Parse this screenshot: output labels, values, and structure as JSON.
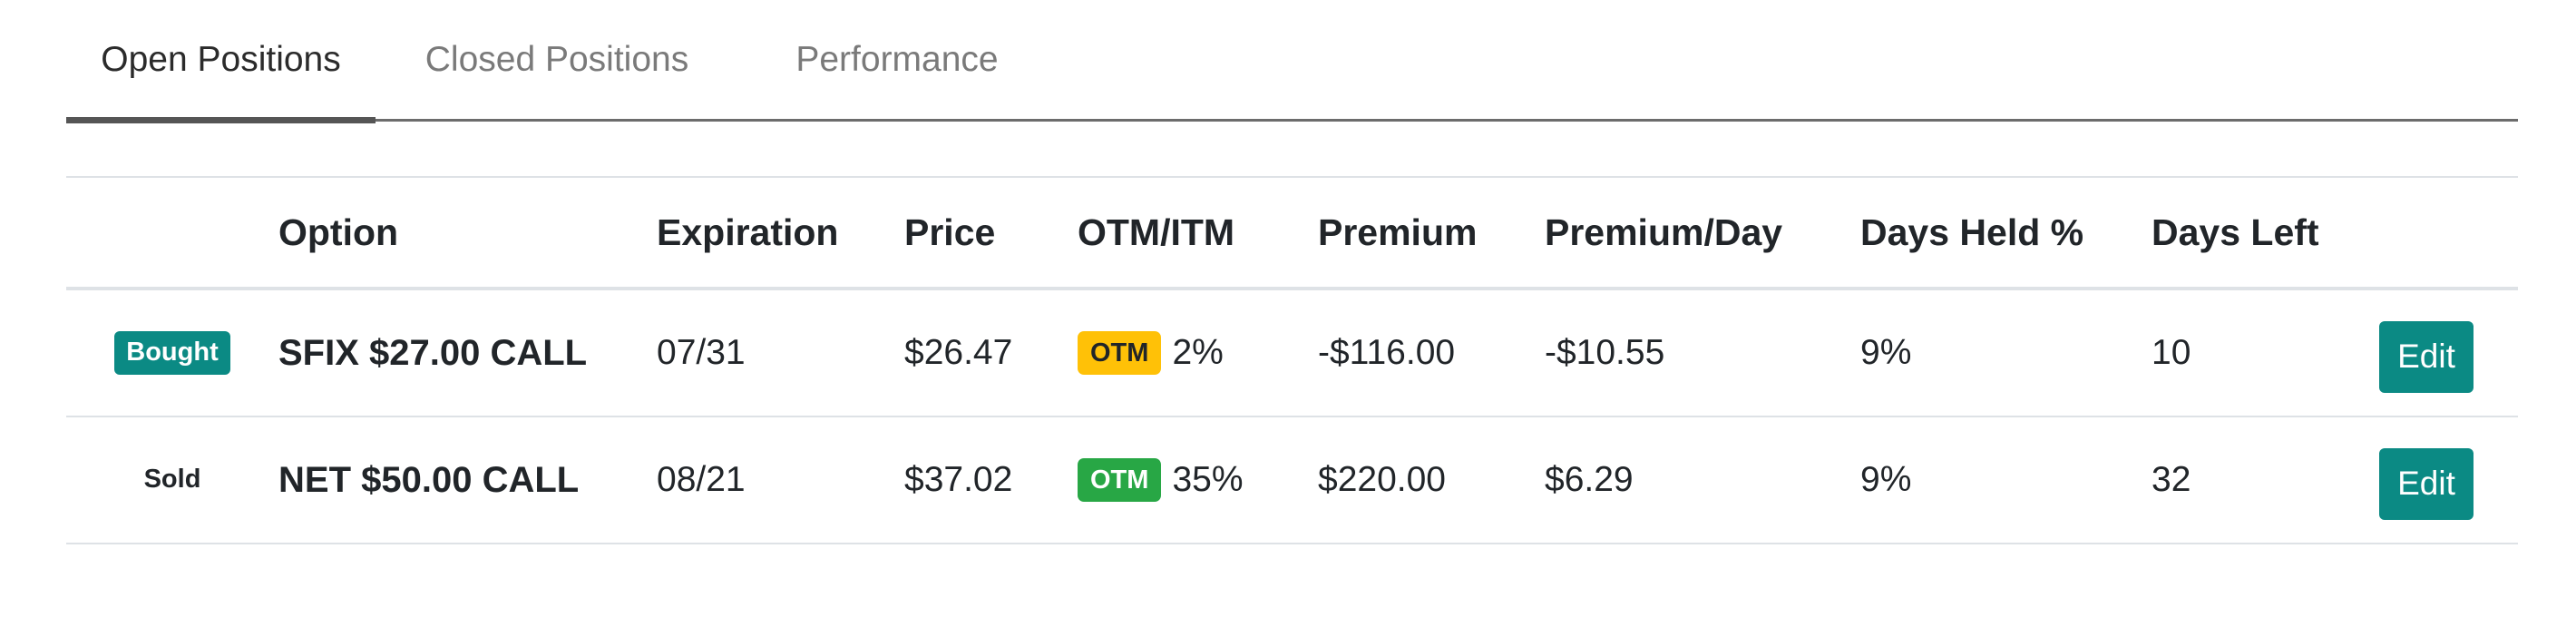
{
  "tabs": [
    {
      "label": "Open Positions",
      "active": true
    },
    {
      "label": "Closed Positions",
      "active": false
    },
    {
      "label": "Performance",
      "active": false
    }
  ],
  "table": {
    "columns": [
      "",
      "Option",
      "Expiration",
      "Price",
      "OTM/ITM",
      "Premium",
      "Premium/Day",
      "Days Held %",
      "Days Left",
      ""
    ],
    "rows": [
      {
        "side": "Bought",
        "option": "SFIX $27.00 CALL",
        "expiration": "07/31",
        "price": "$26.47",
        "moneyness": "OTM",
        "moneyness_pct": "2%",
        "premium": "-$116.00",
        "premium_per_day": "-$10.55",
        "days_held_pct": "9%",
        "days_left": "10",
        "action": "Edit"
      },
      {
        "side": "Sold",
        "option": "NET $50.00 CALL",
        "expiration": "08/21",
        "price": "$37.02",
        "moneyness": "OTM",
        "moneyness_pct": "35%",
        "premium": "$220.00",
        "premium_per_day": "$6.29",
        "days_held_pct": "9%",
        "days_left": "32",
        "action": "Edit"
      }
    ]
  },
  "colors": {
    "teal": "#0b8a84",
    "warning": "#ffc107",
    "success": "#28a745"
  }
}
